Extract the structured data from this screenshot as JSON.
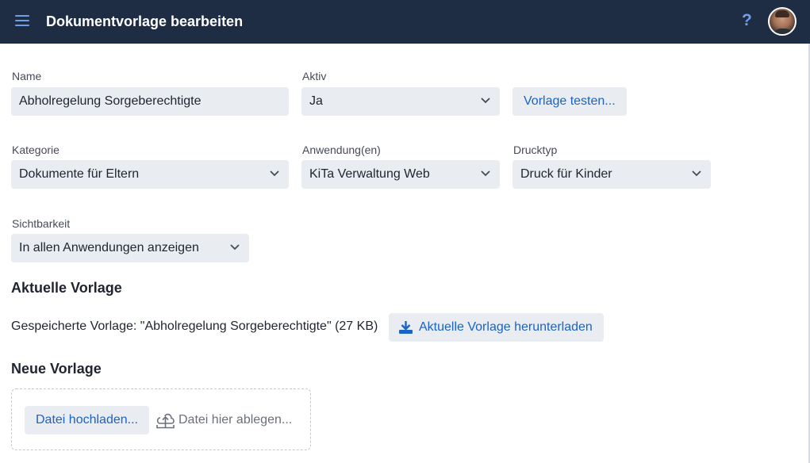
{
  "header": {
    "title": "Dokumentvorlage bearbeiten",
    "menu_icon": "hamburger-menu-icon",
    "help_label": "?",
    "avatar_icon": "user-avatar"
  },
  "form": {
    "name": {
      "label": "Name",
      "value": "Abholregelung Sorgeberechtigte"
    },
    "aktiv": {
      "label": "Aktiv",
      "value": "Ja"
    },
    "test_button": "Vorlage testen...",
    "kategorie": {
      "label": "Kategorie",
      "value": "Dokumente für Eltern"
    },
    "anwendungen": {
      "label": "Anwendung(en)",
      "value": "KiTa Verwaltung Web"
    },
    "drucktyp": {
      "label": "Drucktyp",
      "value": "Druck für Kinder"
    },
    "sichtbarkeit": {
      "label": "Sichtbarkeit",
      "value": "In allen Anwendungen anzeigen"
    }
  },
  "current_template": {
    "heading": "Aktuelle Vorlage",
    "saved_text": "Gespeicherte Vorlage: \"Abholregelung Sorgeberechtigte\" (27 KB)",
    "download_button": "Aktuelle Vorlage herunterladen"
  },
  "new_template": {
    "heading": "Neue Vorlage",
    "upload_button": "Datei hochladen...",
    "drop_text": "Datei hier ablegen..."
  },
  "colors": {
    "topbar": "#1f2d44",
    "accent": "#1a63c7",
    "field_bg": "#e9ecf0"
  }
}
